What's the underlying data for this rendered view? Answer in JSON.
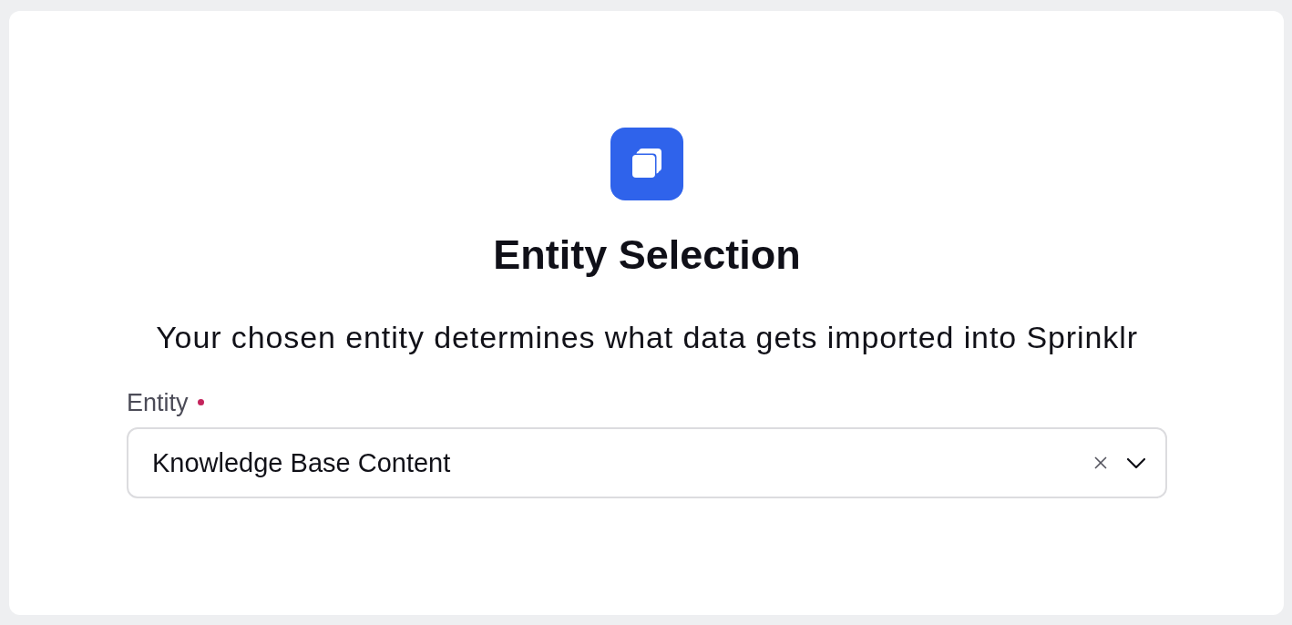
{
  "header": {
    "title": "Entity Selection",
    "subtitle": "Your chosen entity determines what data gets imported into Sprinklr"
  },
  "field": {
    "label": "Entity",
    "required": true,
    "value": "Knowledge Base Content",
    "clearable": true
  }
}
